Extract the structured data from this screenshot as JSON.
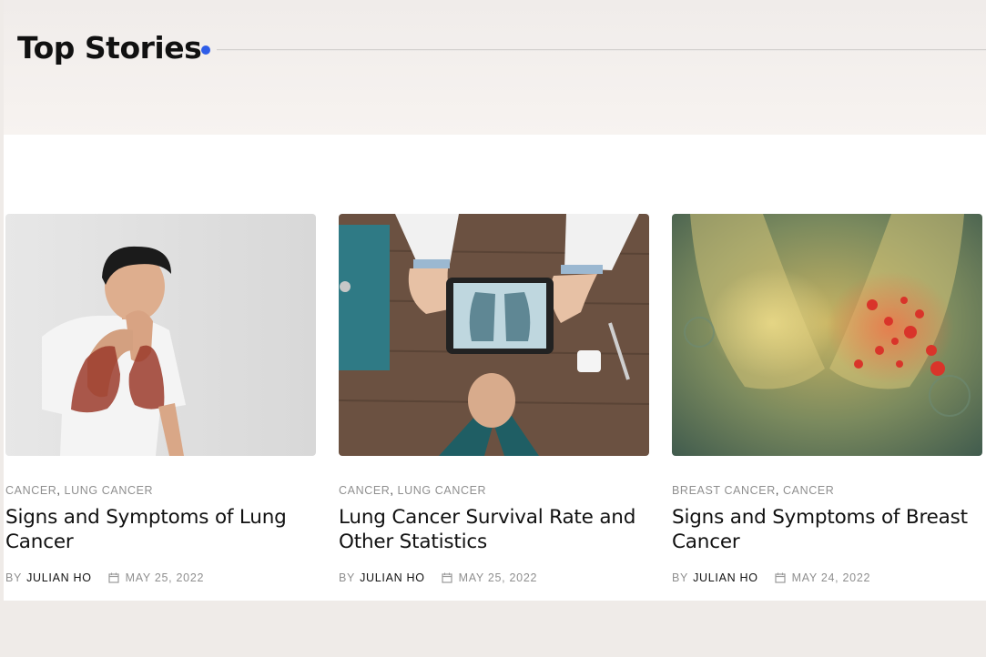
{
  "section": {
    "title": "Top Stories"
  },
  "cards": [
    {
      "image": "man-coughing-with-lungs-overlay",
      "categories": [
        "CANCER",
        "LUNG CANCER"
      ],
      "separator": ",",
      "title": "Signs and Symptoms of Lung Cancer",
      "by": "BY",
      "author": "JULIAN HO",
      "date": "MAY 25, 2022"
    },
    {
      "image": "doctor-tablet-chest-xray",
      "categories": [
        "CANCER",
        "LUNG CANCER"
      ],
      "separator": ",",
      "title": "Lung Cancer Survival Rate and Other Statistics",
      "by": "BY",
      "author": "JULIAN HO",
      "date": "MAY 25, 2022"
    },
    {
      "image": "breast-cancer-illustration",
      "categories": [
        "BREAST CANCER",
        "CANCER"
      ],
      "separator": ",",
      "title": "Signs and Symptoms of Breast Cancer",
      "by": "BY",
      "author": "JULIAN HO",
      "date": "MAY 24, 2022"
    }
  ],
  "colors": {
    "accent_dot": "#2f5de8",
    "meta_gray": "#8f8f8f",
    "title_black": "#111111"
  }
}
